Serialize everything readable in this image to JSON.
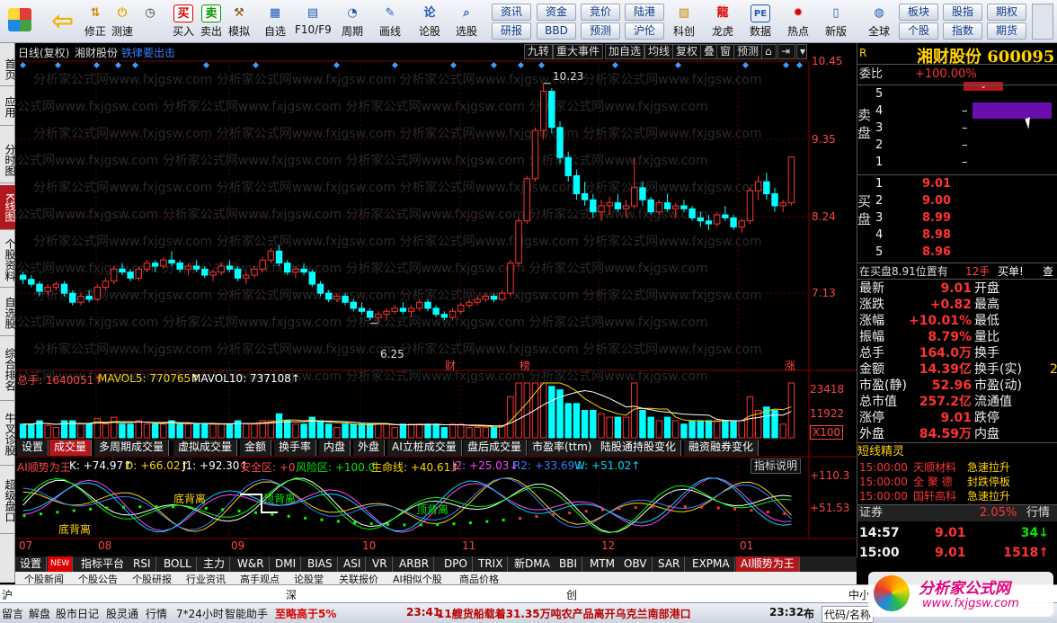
{
  "toolbar": {
    "buttons": [
      {
        "label": "",
        "icon": "windows-icon"
      },
      {
        "label": "",
        "icon": "back-arrow-icon"
      },
      {
        "label": "修正",
        "icon": "correct-icon"
      },
      {
        "label": "测速",
        "icon": "clock-icon"
      },
      {
        "label": "买入",
        "icon": "buy-icon"
      },
      {
        "label": "卖出",
        "icon": "sell-icon"
      },
      {
        "label": "模拟",
        "icon": "hammer-icon"
      },
      {
        "label": "自选",
        "icon": "star-icon"
      },
      {
        "label": "F10/F9",
        "icon": "f10-icon"
      },
      {
        "label": "周期",
        "icon": "period-icon"
      },
      {
        "label": "画线",
        "icon": "pen-icon"
      },
      {
        "label": "论股",
        "icon": "forum-icon"
      },
      {
        "label": "选股",
        "icon": "select-stock-icon"
      },
      {
        "label": "科创",
        "icon": "kechuang-icon"
      },
      {
        "label": "龙虎",
        "icon": "longhu-icon"
      },
      {
        "label": "数据",
        "icon": "pe-icon"
      },
      {
        "label": "热点",
        "icon": "hot-icon"
      },
      {
        "label": "新版",
        "icon": "new-version-icon"
      },
      {
        "label": "全球",
        "icon": "globe-icon"
      }
    ],
    "blue_buttons": [
      "资讯",
      "资金",
      "竞价",
      "陆港",
      "研报",
      "BBD",
      "预测",
      "沪伦",
      "板块",
      "股指",
      "期权",
      "个股",
      "指数",
      "期货"
    ]
  },
  "left_tabs": [
    "首页",
    "应用",
    "分时图",
    "K线图",
    "个股资料",
    "自选股",
    "综合排名",
    "牛叉诊股",
    "超级盘口"
  ],
  "chart_header": {
    "period": "日线(复权)",
    "stock": "湘财股份",
    "link": "铁律要出击"
  },
  "chart_header_buttons": [
    "九转",
    "重大事件",
    "加自选",
    "均线",
    "复权",
    "叠",
    "窗",
    "预测"
  ],
  "price_axis": [
    "10.45",
    "9.35",
    "8.24",
    "7.13"
  ],
  "annotations": {
    "high": "10.23",
    "low": "6.25",
    "mark1": "财",
    "mark2": "榜",
    "mark3": "涨"
  },
  "watermark": "分析家公式网www.fxjgsw.com",
  "volume": {
    "label_total": "总手: 1640051↑",
    "ma5": "MAVOL5: 770765↑",
    "ma10": "MAVOL10: 737108↑",
    "axis": [
      "23418",
      "11922",
      "X100"
    ]
  },
  "sub_tabs": [
    "设置",
    "成交量",
    "多周期成交量",
    "虚拟成交量",
    "金额",
    "换手率",
    "内盘",
    "外盘",
    "AI立桩成交量",
    "盘后成交量",
    "市盈率(ttm)",
    "陆股通持股变化",
    "融资融券变化"
  ],
  "indicator": {
    "name": "AI顺势为王",
    "values": [
      "K: +74.97↑",
      "D: +66.02↑",
      "J1: +92.30↑",
      "安全区: +0",
      "风险区: +100.0",
      "生命线: +40.61↑",
      "J2: +25.03↓",
      "R2: +33.69↓",
      "W: +51.02↑"
    ],
    "help": "指标说明",
    "axis": [
      "+110.3",
      "+51.53"
    ],
    "labels": [
      "底背离",
      "底背离",
      "顶背离",
      "顶背离"
    ]
  },
  "date_axis": [
    "07",
    "08",
    "09",
    "10",
    "11",
    "12",
    "01"
  ],
  "bottom_tabs": [
    "设置",
    "指标平台",
    "RSI",
    "BOLL",
    "主力",
    "W&R",
    "DMI",
    "BIAS",
    "ASI",
    "VR",
    "ARBR",
    "DPO",
    "TRIX",
    "新DMA",
    "BBI",
    "MTM",
    "OBV",
    "SAR",
    "EXPMA",
    "AI顺势为王"
  ],
  "bottom_tabs_new_badge": "NEW",
  "bottom_tabs2": [
    "个股新闻",
    "个股公告",
    "个股研报",
    "行业资讯",
    "高手观点",
    "论股堂",
    "关联报价",
    "AI相似个股",
    "商品价格"
  ],
  "market_bar": [
    "沪",
    "深",
    "创",
    "中小"
  ],
  "status": {
    "items": [
      "留言",
      "解盘",
      "股市日记",
      "股灵通",
      "行情",
      "7*24小时",
      "智能助手"
    ],
    "promo": "至略高于5%",
    "news_time": "23:41",
    "news": "11艘货船载着31.35万吨农产品离开乌克兰南部港口",
    "time2": "23:32",
    "time2_suffix": "布",
    "code_label": "代码/名称"
  },
  "right_panel": {
    "title": "湘财股份 600095",
    "r_label": "R",
    "weibi": {
      "label": "委比",
      "value": "+100.00%"
    },
    "sell_label": "卖盘",
    "buy_label": "买盘",
    "sell": [
      {
        "lvl": "5",
        "price": "",
        "vol": ""
      },
      {
        "lvl": "4",
        "price": "–",
        "vol": ""
      },
      {
        "lvl": "3",
        "price": "–",
        "vol": ""
      },
      {
        "lvl": "2",
        "price": "–",
        "vol": ""
      },
      {
        "lvl": "1",
        "price": "–",
        "vol": ""
      }
    ],
    "buy": [
      {
        "lvl": "1",
        "price": "9.01"
      },
      {
        "lvl": "2",
        "price": "9.00"
      },
      {
        "lvl": "3",
        "price": "8.99"
      },
      {
        "lvl": "4",
        "price": "8.98"
      },
      {
        "lvl": "5",
        "price": "8.96"
      }
    ],
    "queue": {
      "text": "在买盘8.91位置有",
      "vol": "12手",
      "action": "买单!",
      "more": "查"
    },
    "stats": [
      {
        "k": "最新",
        "v": "9.01",
        "k2": "开盘"
      },
      {
        "k": "涨跌",
        "v": "+0.82",
        "k2": "最高"
      },
      {
        "k": "涨幅",
        "v": "+10.01%",
        "k2": "最低"
      },
      {
        "k": "振幅",
        "v": "8.79%",
        "k2": "量比"
      },
      {
        "k": "总手",
        "v": "164.0万",
        "k2": "换手"
      },
      {
        "k": "金额",
        "v": "14.39亿",
        "k2": "换手(实)",
        "v2": "2"
      },
      {
        "k": "市盈(静)",
        "v": "52.96",
        "k2": "市盈(动)"
      },
      {
        "k": "总市值",
        "v": "257.2亿",
        "k2": "流通值"
      },
      {
        "k": "涨停",
        "v": "9.01",
        "k2": "跌停"
      },
      {
        "k": "外盘",
        "v": "84.59万",
        "k2": "内盘"
      }
    ],
    "short_title": "短线精灵",
    "short": [
      {
        "time": "15:00:00",
        "name": "天顺材料",
        "event": "急速拉升"
      },
      {
        "time": "15:00:00",
        "name": "全 聚 德",
        "event": "封跌停板"
      },
      {
        "time": "15:00:00",
        "name": "国轩高科",
        "event": "急速拉升"
      }
    ],
    "sector": {
      "name": "证券",
      "pct": "2.05%",
      "more": "行情"
    },
    "ticks": [
      {
        "time": "14:57",
        "price": "9.01",
        "vol": "34"
      },
      {
        "time": "15:00",
        "price": "9.01",
        "vol": "1518"
      }
    ],
    "logo": "分析家公式网",
    "logo_url": "www.fxjgsw.com"
  },
  "chart_data": {
    "type": "candlestick",
    "x_ticks": [
      "07",
      "08",
      "09",
      "10",
      "11",
      "12",
      "01"
    ],
    "y_ticks": [
      10.45,
      9.35,
      8.24,
      7.13
    ],
    "ylim": [
      5.5,
      10.6
    ],
    "ohlc": [
      [
        7.05,
        7.1,
        6.9,
        6.98
      ],
      [
        6.98,
        7.05,
        6.85,
        6.9
      ],
      [
        6.9,
        6.95,
        6.7,
        6.78
      ],
      [
        6.78,
        6.9,
        6.72,
        6.85
      ],
      [
        6.85,
        6.95,
        6.8,
        6.9
      ],
      [
        6.9,
        6.95,
        6.7,
        6.75
      ],
      [
        6.75,
        6.8,
        6.55,
        6.6
      ],
      [
        6.6,
        6.75,
        6.55,
        6.7
      ],
      [
        6.7,
        6.8,
        6.6,
        6.65
      ],
      [
        6.65,
        6.9,
        6.62,
        6.85
      ],
      [
        6.85,
        7.0,
        6.8,
        6.95
      ],
      [
        6.95,
        7.2,
        6.9,
        7.15
      ],
      [
        7.15,
        7.25,
        7.05,
        7.1
      ],
      [
        7.1,
        7.15,
        6.95,
        7.0
      ],
      [
        7.0,
        7.2,
        6.95,
        7.15
      ],
      [
        7.15,
        7.3,
        7.1,
        7.25
      ],
      [
        7.25,
        7.3,
        7.1,
        7.2
      ],
      [
        7.2,
        7.35,
        7.15,
        7.3
      ],
      [
        7.3,
        7.45,
        7.2,
        7.25
      ],
      [
        7.25,
        7.3,
        7.1,
        7.15
      ],
      [
        7.15,
        7.25,
        7.05,
        7.2
      ],
      [
        7.2,
        7.3,
        7.1,
        7.15
      ],
      [
        7.15,
        7.2,
        7.0,
        7.05
      ],
      [
        7.05,
        7.15,
        6.95,
        7.1
      ],
      [
        7.1,
        7.25,
        7.05,
        7.2
      ],
      [
        7.2,
        7.3,
        7.1,
        7.15
      ],
      [
        7.15,
        7.2,
        6.95,
        7.0
      ],
      [
        7.0,
        7.1,
        6.9,
        7.05
      ],
      [
        7.05,
        7.2,
        7.0,
        7.15
      ],
      [
        7.15,
        7.35,
        7.1,
        7.3
      ],
      [
        7.3,
        7.5,
        7.25,
        7.45
      ],
      [
        7.45,
        7.55,
        7.2,
        7.25
      ],
      [
        7.25,
        7.3,
        7.05,
        7.1
      ],
      [
        7.1,
        7.2,
        7.0,
        7.15
      ],
      [
        7.15,
        7.25,
        7.05,
        7.1
      ],
      [
        7.1,
        7.15,
        6.85,
        6.9
      ],
      [
        6.9,
        6.95,
        6.7,
        6.75
      ],
      [
        6.75,
        6.8,
        6.6,
        6.65
      ],
      [
        6.65,
        6.75,
        6.6,
        6.7
      ],
      [
        6.7,
        6.75,
        6.55,
        6.6
      ],
      [
        6.6,
        6.65,
        6.45,
        6.5
      ],
      [
        6.5,
        6.6,
        6.4,
        6.45
      ],
      [
        6.45,
        6.5,
        6.3,
        6.35
      ],
      [
        6.35,
        6.45,
        6.25,
        6.4
      ],
      [
        6.4,
        6.5,
        6.3,
        6.45
      ],
      [
        6.45,
        6.55,
        6.4,
        6.5
      ],
      [
        6.5,
        6.6,
        6.4,
        6.45
      ],
      [
        6.45,
        6.55,
        6.35,
        6.5
      ],
      [
        6.5,
        6.65,
        6.45,
        6.6
      ],
      [
        6.6,
        6.65,
        6.45,
        6.5
      ],
      [
        6.5,
        6.55,
        6.35,
        6.4
      ],
      [
        6.4,
        6.45,
        6.3,
        6.35
      ],
      [
        6.35,
        6.5,
        6.3,
        6.45
      ],
      [
        6.45,
        6.6,
        6.4,
        6.55
      ],
      [
        6.55,
        6.65,
        6.5,
        6.6
      ],
      [
        6.6,
        6.7,
        6.55,
        6.65
      ],
      [
        6.65,
        6.75,
        6.6,
        6.7
      ],
      [
        6.7,
        6.75,
        6.6,
        6.65
      ],
      [
        6.65,
        6.8,
        6.62,
        6.75
      ],
      [
        6.75,
        7.3,
        6.7,
        7.25
      ],
      [
        7.25,
        8.0,
        7.2,
        7.95
      ],
      [
        7.95,
        8.7,
        7.9,
        8.65
      ],
      [
        8.65,
        9.5,
        8.6,
        9.45
      ],
      [
        9.45,
        10.23,
        9.3,
        10.1
      ],
      [
        10.1,
        10.15,
        9.4,
        9.5
      ],
      [
        9.5,
        9.6,
        8.9,
        9.0
      ],
      [
        9.0,
        9.1,
        8.6,
        8.7
      ],
      [
        8.7,
        8.8,
        8.3,
        8.4
      ],
      [
        8.4,
        8.6,
        8.2,
        8.3
      ],
      [
        8.3,
        8.4,
        8.0,
        8.1
      ],
      [
        8.1,
        8.3,
        7.95,
        8.2
      ],
      [
        8.2,
        8.35,
        8.05,
        8.25
      ],
      [
        8.25,
        8.4,
        8.1,
        8.15
      ],
      [
        8.15,
        8.3,
        8.0,
        8.2
      ],
      [
        8.2,
        9.0,
        8.15,
        8.5
      ],
      [
        8.5,
        8.6,
        8.2,
        8.3
      ],
      [
        8.3,
        8.35,
        8.05,
        8.1
      ],
      [
        8.1,
        8.3,
        8.05,
        8.25
      ],
      [
        8.25,
        8.4,
        8.1,
        8.15
      ],
      [
        8.15,
        8.25,
        8.0,
        8.2
      ],
      [
        8.2,
        8.3,
        8.1,
        8.15
      ],
      [
        8.15,
        8.2,
        7.95,
        8.0
      ],
      [
        8.0,
        8.1,
        7.85,
        7.95
      ],
      [
        7.95,
        8.05,
        7.8,
        7.9
      ],
      [
        7.9,
        8.1,
        7.85,
        8.05
      ],
      [
        8.05,
        8.2,
        7.95,
        8.0
      ],
      [
        8.0,
        8.05,
        7.8,
        7.85
      ],
      [
        7.85,
        8.0,
        7.75,
        7.95
      ],
      [
        7.95,
        8.5,
        7.9,
        8.45
      ],
      [
        8.45,
        8.7,
        8.3,
        8.6
      ],
      [
        8.6,
        8.75,
        8.3,
        8.4
      ],
      [
        8.4,
        8.5,
        8.1,
        8.2
      ],
      [
        8.2,
        8.3,
        8.1,
        8.25
      ],
      [
        8.25,
        9.01,
        8.2,
        9.01
      ]
    ],
    "volume_ma5": 770765,
    "volume_ma10": 737108
  }
}
